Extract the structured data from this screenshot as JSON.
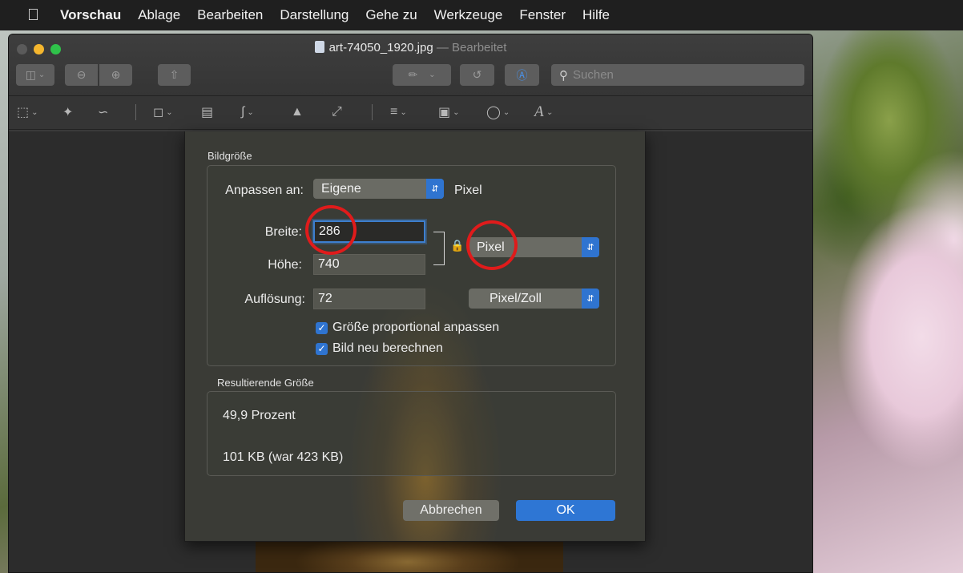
{
  "menubar": {
    "apple": "",
    "items": [
      "Vorschau",
      "Ablage",
      "Bearbeiten",
      "Darstellung",
      "Gehe zu",
      "Werkzeuge",
      "Fenster",
      "Hilfe"
    ]
  },
  "window": {
    "filename": "art-74050_1920.jpg",
    "separator": " — ",
    "status": "Bearbeitet",
    "search_placeholder": "Suchen"
  },
  "dialog": {
    "image_size_label": "Bildgröße",
    "fit_label": "Anpassen an:",
    "fit_value": "Eigene",
    "fit_unit": "Pixel",
    "width_label": "Breite:",
    "width_value": "286",
    "height_label": "Höhe:",
    "height_value": "740",
    "size_unit": "Pixel",
    "resolution_label": "Auflösung:",
    "resolution_value": "72",
    "resolution_unit": "Pixel/Zoll",
    "scale_proportionally": "Größe proportional anpassen",
    "scale_proportionally_checked": true,
    "resample": "Bild neu berechnen",
    "resample_checked": true,
    "result_label": "Resultierende Größe",
    "result_percent": "49,9 Prozent",
    "result_size": "101 KB (war 423 KB)",
    "cancel_label": "Abbrechen",
    "ok_label": "OK"
  },
  "colors": {
    "accent": "#2e76d4",
    "annotation": "#e01b1b",
    "traffic_minimize": "#f5b62e",
    "traffic_maximize": "#2fc24a"
  }
}
